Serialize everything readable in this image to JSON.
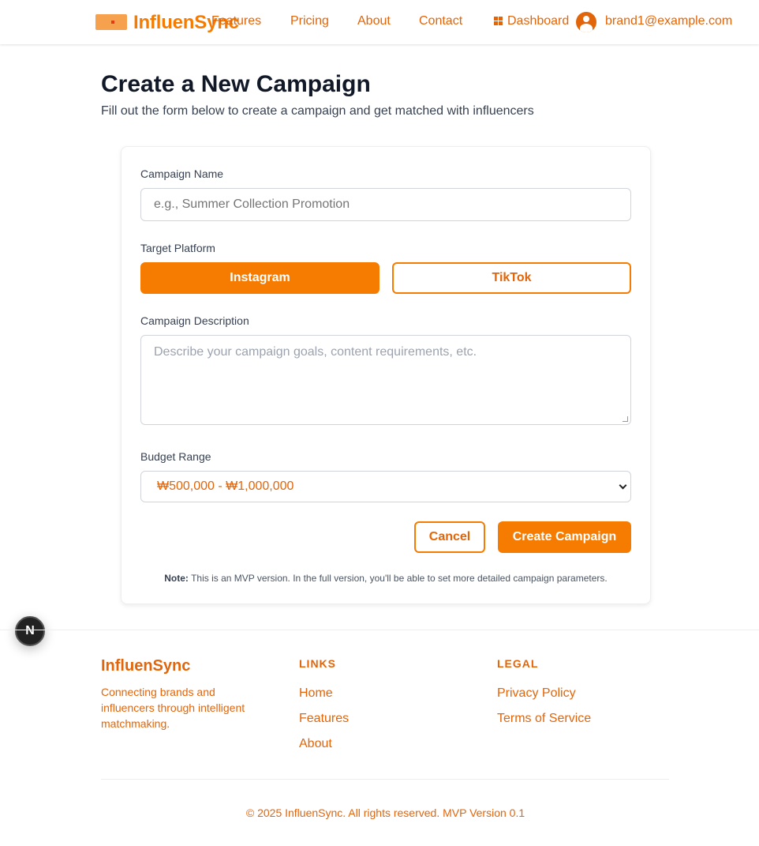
{
  "header": {
    "brand": "InfluenSync",
    "nav": [
      "Features",
      "Pricing",
      "About",
      "Contact"
    ],
    "dashboard_label": "Dashboard",
    "user_email": "brand1@example.com"
  },
  "page": {
    "title": "Create a New Campaign",
    "subtitle": "Fill out the form below to create a campaign and get matched with influencers"
  },
  "form": {
    "campaign_name_label": "Campaign Name",
    "campaign_name_placeholder": "e.g., Summer Collection Promotion",
    "campaign_name_value": "",
    "platform_label": "Target Platform",
    "platforms": [
      "Instagram",
      "TikTok"
    ],
    "selected_platform": "Instagram",
    "description_label": "Campaign Description",
    "description_placeholder": "Describe your campaign goals, content requirements, etc.",
    "budget_label": "Budget Range",
    "budget_selected": "₩500,000 - ₩1,000,000",
    "cancel_label": "Cancel",
    "create_label": "Create Campaign",
    "note_prefix": "Note:",
    "note_text": "This is an MVP version. In the full version, you'll be able to set more detailed campaign parameters."
  },
  "dev_badge": "N",
  "footer": {
    "brand": "InfluenSync",
    "tagline": "Connecting brands and influencers through intelligent matchmaking.",
    "links_heading": "LINKS",
    "links": [
      "Home",
      "Features",
      "About"
    ],
    "legal_heading": "LEGAL",
    "legal": [
      "Privacy Policy",
      "Terms of Service"
    ],
    "copyright": "© 2025 InfluenSync. All rights reserved. MVP Version 0.1"
  },
  "colors": {
    "accent": "#f57c00",
    "accent_text": "#e3650a",
    "heading": "#111827"
  }
}
